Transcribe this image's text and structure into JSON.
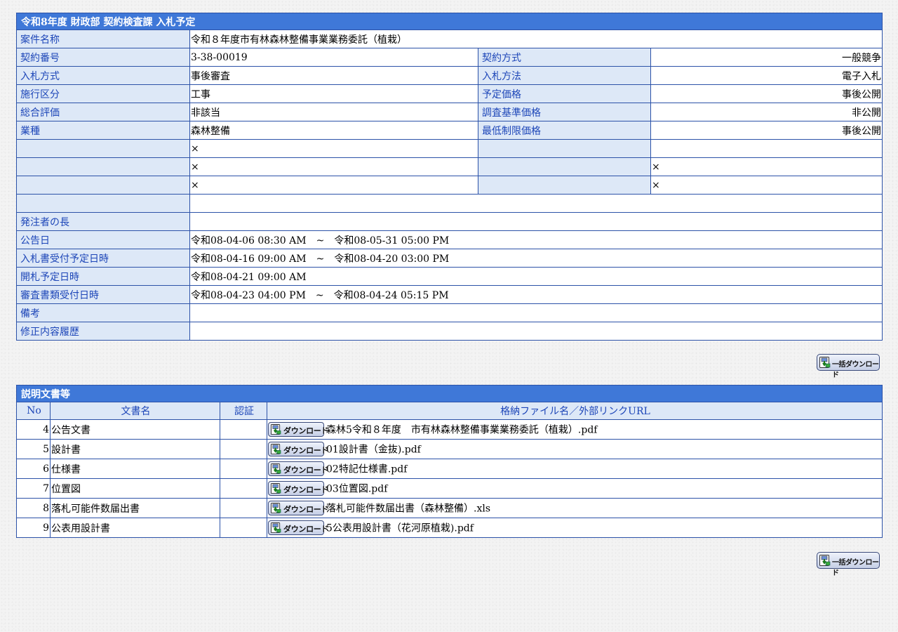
{
  "main": {
    "header": "令和8年度 財政部 契約検査課 入札予定",
    "project_name": {
      "label": "案件名称",
      "value": "令和８年度市有林森林整備事業業務委託（植栽）"
    },
    "rows": [
      {
        "l1": "契約番号",
        "v1": "3-38-00019",
        "l2": "契約方式",
        "v2": "一般競争"
      },
      {
        "l1": "入札方式",
        "v1": "事後審査",
        "l2": "入札方法",
        "v2": "電子入札"
      },
      {
        "l1": "施行区分",
        "v1": "工事",
        "l2": "予定価格",
        "v2": "事後公開"
      },
      {
        "l1": "総合評価",
        "v1": "非該当",
        "l2": "調査基準価格",
        "v2": "非公開"
      },
      {
        "l1": "業種",
        "v1": "森林整備",
        "l2": "最低制限価格",
        "v2": "事後公開"
      },
      {
        "l1": "",
        "v1": "×",
        "l2": "",
        "v2": ""
      },
      {
        "l1": "",
        "v1": "×",
        "l2": "",
        "v2": "×"
      },
      {
        "l1": "",
        "v1": "×",
        "l2": "",
        "v2": "×"
      }
    ],
    "blank_row": {
      "label": "",
      "value": ""
    },
    "orderer": {
      "label": "発注者の長",
      "value": ""
    },
    "announce": {
      "label": "公告日",
      "value": "令和08-04-06 08:30 AM　~　令和08-05-31 05:00 PM"
    },
    "bid_receipt": {
      "label": "入札書受付予定日時",
      "value": "令和08-04-16 09:00 AM　~　令和08-04-20 03:00 PM"
    },
    "opening": {
      "label": "開札予定日時",
      "value": "令和08-04-21 09:00 AM"
    },
    "review_docs": {
      "label": "審査書類受付日時",
      "value": "令和08-04-23 04:00 PM　~　令和08-04-24 05:15 PM"
    },
    "remarks": {
      "label": "備考",
      "value": ""
    },
    "revision": {
      "label": "修正内容履歴",
      "value": ""
    }
  },
  "bulk_download_label": "一括ダウンロード",
  "docs": {
    "header": "説明文書等",
    "columns": {
      "no": "No",
      "name": "文書名",
      "cert": "認証",
      "file": "格納ファイル名／外部リンクURL"
    },
    "download_label": "ダウンロード",
    "items": [
      {
        "no": "4",
        "name": "公告文書",
        "cert": "",
        "file": "森林5令和８年度　市有林森林整備事業業務委託（植栽）.pdf"
      },
      {
        "no": "5",
        "name": "設計書",
        "cert": "",
        "file": "01設計書（金抜).pdf"
      },
      {
        "no": "6",
        "name": "仕様書",
        "cert": "",
        "file": "02特記仕様書.pdf"
      },
      {
        "no": "7",
        "name": "位置図",
        "cert": "",
        "file": "03位置図.pdf"
      },
      {
        "no": "8",
        "name": "落札可能件数届出書",
        "cert": "",
        "file": "落札可能件数届出書（森林整備）.xls"
      },
      {
        "no": "9",
        "name": "公表用設計書",
        "cert": "",
        "file": "5公表用設計書（花河原植栽).pdf"
      }
    ]
  },
  "colors": {
    "header_bg": "#3f78d8",
    "label_bg": "#dde8f7",
    "label_text": "#1d46b8",
    "border": "#2c52a8"
  }
}
